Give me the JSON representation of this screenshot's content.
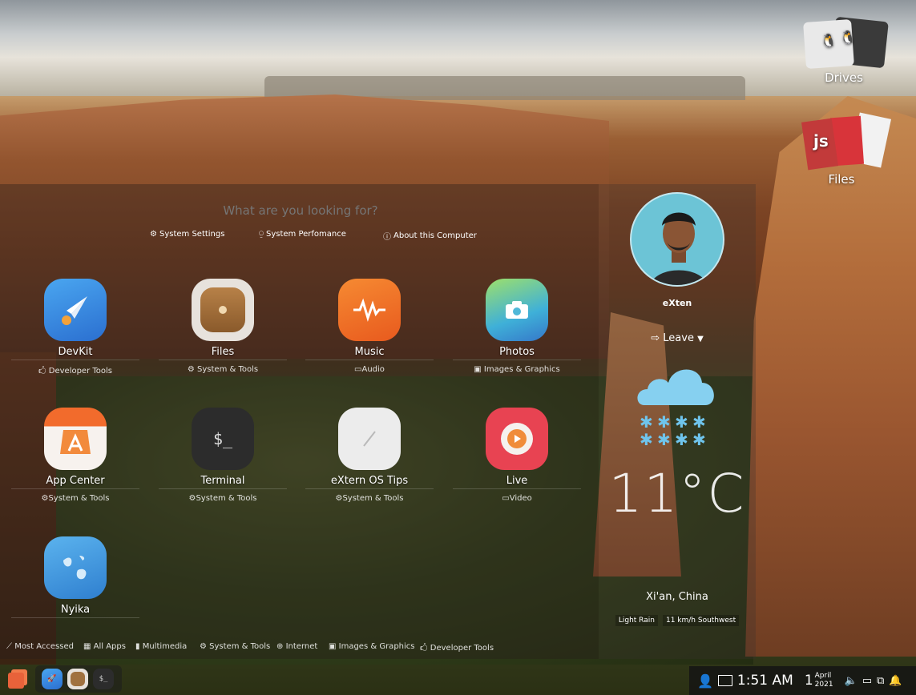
{
  "search": {
    "placeholder": "What are you looking for?"
  },
  "quick_links": [
    {
      "label": "System Settings",
      "icon": "gear-icon"
    },
    {
      "label": "System Perfomance",
      "icon": "gauge-icon"
    },
    {
      "label": "About this Computer",
      "icon": "info-icon"
    }
  ],
  "apps": [
    {
      "name": "DevKit",
      "category": "Developer Tools",
      "icon": "rocket-icon",
      "color": "#3a8ee6"
    },
    {
      "name": "Files",
      "category": "System & Tools",
      "icon": "folder-icon",
      "color": "#a0713f"
    },
    {
      "name": "Music",
      "category": "Audio",
      "icon": "music-icon",
      "color": "#f0722a"
    },
    {
      "name": "Photos",
      "category": "Images & Graphics",
      "icon": "camera-icon",
      "color": "#4fb8d8"
    },
    {
      "name": "App Center",
      "category": "System & Tools",
      "icon": "shopping-bag-icon",
      "color": "#ef6a2d"
    },
    {
      "name": "Terminal",
      "category": "System & Tools",
      "icon": "terminal-icon",
      "color": "#2f2f2f"
    },
    {
      "name": "eXtern OS Tips",
      "category": "System & Tools",
      "icon": "tips-icon",
      "color": "#e8e8e8"
    },
    {
      "name": "Live",
      "category": "Video",
      "icon": "play-icon",
      "color": "#e84352"
    },
    {
      "name": "Nyika",
      "category": "",
      "icon": "globe-icon",
      "color": "#3f95d8"
    }
  ],
  "terminal_glyph": "$_",
  "categories": [
    {
      "label": "Most Accessed",
      "icon": "chart-icon"
    },
    {
      "label": "All Apps",
      "icon": "grid-icon"
    },
    {
      "label": "Multimedia",
      "icon": "film-icon"
    },
    {
      "label": "System & Tools",
      "icon": "gear-icon"
    },
    {
      "label": "Internet",
      "icon": "globe-icon"
    },
    {
      "label": "Images & Graphics",
      "icon": "image-icon"
    },
    {
      "label": "Developer Tools",
      "icon": "code-icon"
    }
  ],
  "user": {
    "name": "eXten",
    "leave_label": "Leave"
  },
  "weather": {
    "temperature": "11°C",
    "city": "Xi'an, China",
    "condition": "Light Rain",
    "wind": "11 km/h Southwest"
  },
  "desktop": {
    "drives_label": "Drives",
    "files_label": "Files",
    "js_badge": "js"
  },
  "taskbar": {
    "time": "1:51 AM",
    "day": "1",
    "month": "April",
    "year": "2021",
    "dock_terminal_glyph": "$_"
  }
}
